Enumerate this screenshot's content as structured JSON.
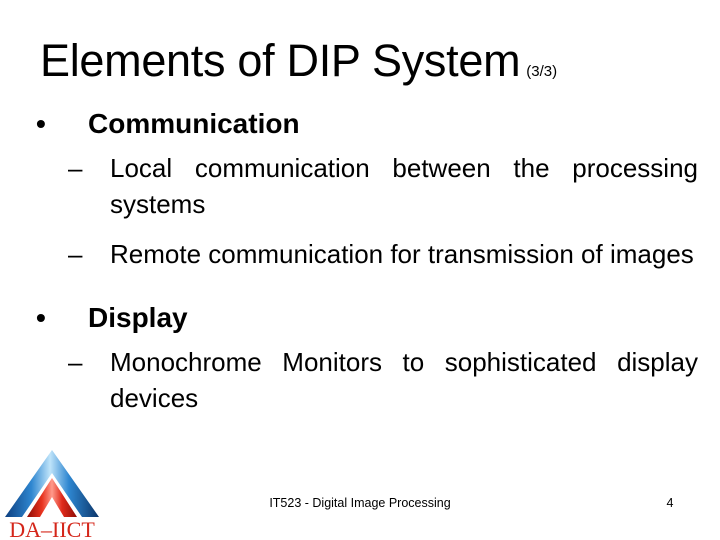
{
  "slide": {
    "title": {
      "main": "Elements of DIP System",
      "superscript": "(3/3)"
    },
    "bullets": [
      {
        "label": "Communication",
        "marker": "•",
        "sub": [
          {
            "marker": "–",
            "text": "Local communication between the processing systems"
          },
          {
            "marker": "–",
            "text": "Remote communication for transmission of images"
          }
        ]
      },
      {
        "label": "Display",
        "marker": "•",
        "sub": [
          {
            "marker": "–",
            "text": "Monochrome Monitors to sophisticated display devices"
          }
        ]
      }
    ],
    "footer": {
      "course": "IT523 - Digital Image Processing",
      "page_number": "4"
    },
    "logo": {
      "text": "DA–IICT",
      "outer_color": "#1f6fc4",
      "outer_highlight": "#9fd3f2",
      "outer_shadow": "#0d3f80",
      "inner_color": "#e02b1c",
      "inner_highlight": "#ff8d7d",
      "inner_shadow": "#9b0f06",
      "text_color": "#d4261a"
    },
    "colors": {
      "background": "#ffffff",
      "text": "#000000"
    }
  }
}
